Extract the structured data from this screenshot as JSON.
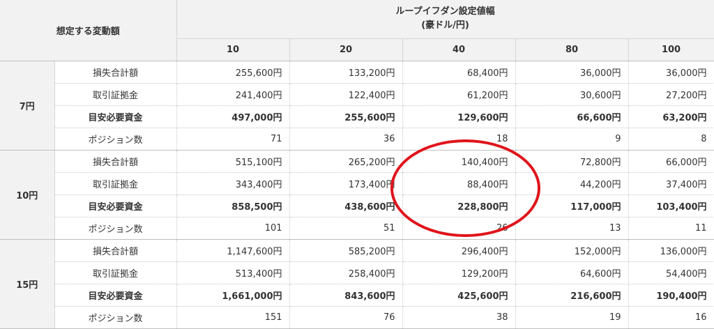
{
  "header": {
    "corner": "想定する変動額",
    "title_line1": "ループイフダン設定値幅",
    "title_line2": "(豪ドル/円)",
    "columns": [
      "10",
      "20",
      "40",
      "80",
      "100"
    ]
  },
  "row_labels": [
    "損失合計額",
    "取引証拠金",
    "目安必要資金",
    "ポジション数"
  ],
  "groups": [
    {
      "label": "7円",
      "rows": [
        [
          "255,600円",
          "133,200円",
          "68,400円",
          "36,000円",
          "36,000円"
        ],
        [
          "241,400円",
          "122,400円",
          "61,200円",
          "30,600円",
          "27,200円"
        ],
        [
          "497,000円",
          "255,600円",
          "129,600円",
          "66,600円",
          "63,200円"
        ],
        [
          "71",
          "36",
          "18",
          "9",
          "8"
        ]
      ]
    },
    {
      "label": "10円",
      "rows": [
        [
          "515,100円",
          "265,200円",
          "140,400円",
          "72,800円",
          "66,000円"
        ],
        [
          "343,400円",
          "173,400円",
          "88,400円",
          "44,200円",
          "37,400円"
        ],
        [
          "858,500円",
          "438,600円",
          "228,800円",
          "117,000円",
          "103,400円"
        ],
        [
          "101",
          "51",
          "26",
          "13",
          "11"
        ]
      ]
    },
    {
      "label": "15円",
      "rows": [
        [
          "1,147,600円",
          "585,200円",
          "296,400円",
          "152,000円",
          "136,000円"
        ],
        [
          "513,400円",
          "258,400円",
          "129,200円",
          "64,600円",
          "54,400円"
        ],
        [
          "1,661,000円",
          "843,600円",
          "425,600円",
          "216,600円",
          "190,400円"
        ],
        [
          "151",
          "76",
          "38",
          "19",
          "16"
        ]
      ]
    }
  ],
  "colors": {
    "header_bg": "#f2f2f2",
    "annotation": "#e0141b"
  }
}
